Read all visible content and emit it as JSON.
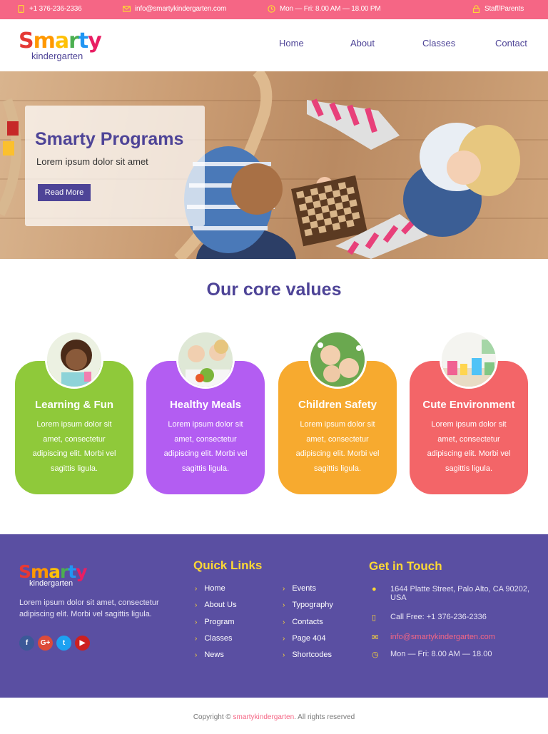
{
  "topbar": {
    "phone": "+1 376-236-2336",
    "email": "info@smartykindergarten.com",
    "hours": "Mon — Fri: 8.00 AM — 18.00 PM",
    "staff": "Staff/Parents"
  },
  "logo": {
    "sub": "kindergarten",
    "letters": [
      "S",
      "m",
      "a",
      "r",
      "t",
      "y"
    ],
    "colors": [
      "#e53935",
      "#ff9800",
      "#ffc107",
      "#4caf50",
      "#2196f3",
      "#e91e63"
    ]
  },
  "nav": [
    "Home",
    "About",
    "Classes",
    "Contact"
  ],
  "hero": {
    "title": "Smarty Programs",
    "subtitle": "Lorem ipsum dolor sit amet",
    "button": "Read More"
  },
  "core": {
    "title": "Our core values",
    "cards": [
      {
        "title": "Learning & Fun",
        "text": "Lorem ipsum dolor sit amet, consectetur adipiscing elit. Morbi vel sagittis ligula.",
        "color": "#8fc93a"
      },
      {
        "title": "Healthy Meals",
        "text": "Lorem ipsum dolor sit amet, consectetur adipiscing elit. Morbi vel sagittis ligula.",
        "color": "#b35df2"
      },
      {
        "title": "Children Safety",
        "text": "Lorem ipsum dolor sit amet, consectetur adipiscing elit. Morbi vel sagittis ligula.",
        "color": "#f7aa2f"
      },
      {
        "title": "Cute Environment",
        "text": "Lorem ipsum dolor sit amet, consectetur adipiscing elit. Morbi vel sagittis ligula.",
        "color": "#f36568"
      }
    ]
  },
  "footer": {
    "about": "Lorem ipsum dolor sit amet, consectetur adipiscing elit. Morbi vel sagittis ligula.",
    "social": [
      "f",
      "G+",
      "t",
      "▶"
    ],
    "quick_links_title": "Quick Links",
    "links_col1": [
      "Home",
      "About Us",
      "Program",
      "Classes",
      "News"
    ],
    "links_col2": [
      "Events",
      "Typography",
      "Contacts",
      "Page 404",
      "Shortcodes"
    ],
    "contact_title": "Get in Touch",
    "address": "1644 Platte Street, Palo Alto, CA 90202, USA",
    "phone": "Call Free: +1 376-236-2336",
    "email": "info@smartykindergarten.com",
    "hours": "Mon — Fri: 8.00 AM — 18.00"
  },
  "copyright": {
    "prefix": "Copyright ©",
    "link": "smartykindergarten",
    "suffix": ". All rights reserved"
  }
}
